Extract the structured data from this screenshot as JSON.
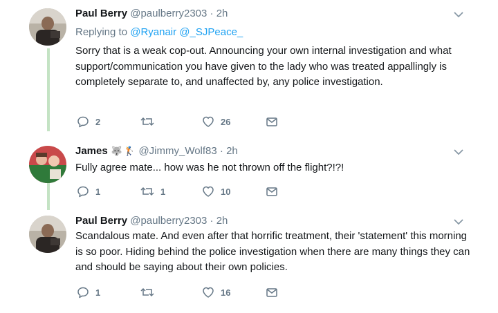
{
  "tweets": [
    {
      "author": "Paul Berry",
      "handle": "@paulberry2303",
      "dot": "·",
      "time": "2h",
      "replying_prefix": "Replying to",
      "replying_to": "@Ryanair @_SJPeace_",
      "text": "Sorry that is a weak cop-out. Announcing your own internal investigation and what support/communication you have given to the lady who was treated appallingly is completely separate to, and unaffected by, any police investigation.",
      "replies": "2",
      "retweets": "",
      "likes": "26",
      "avatar_icon": "avatar-man-photo"
    },
    {
      "author": "James",
      "emojis": [
        "wolf-face-emoji",
        "golfer-emoji"
      ],
      "handle": "@Jimmy_Wolf83",
      "dot": "·",
      "time": "2h",
      "text": "Fully agree mate... how was he not thrown off the flight?!?!",
      "replies": "1",
      "retweets": "1",
      "likes": "10",
      "avatar_icon": "avatar-group-photo"
    },
    {
      "author": "Paul Berry",
      "handle": "@paulberry2303",
      "dot": "·",
      "time": "2h",
      "text": "Scandalous mate. And even after that horrific treatment, their 'statement' this morning is so poor. Hiding behind the police investigation when there are many things they can and should be saying about their own policies.",
      "replies": "1",
      "retweets": "",
      "likes": "16",
      "avatar_icon": "avatar-man-photo"
    }
  ],
  "colors": {
    "thread_line": "#c4e3c4",
    "link": "#1da1f2",
    "secondary": "#657786",
    "primary_text": "#14171a"
  }
}
